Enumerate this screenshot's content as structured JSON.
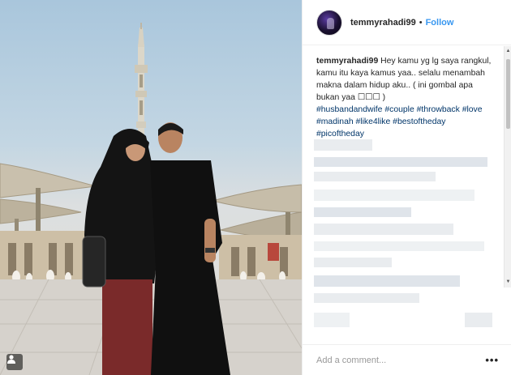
{
  "post": {
    "photo_description_icon": "user-tag-icon",
    "account": {
      "username": "temmyrahadi99",
      "separator": "•",
      "follow_label": "Follow"
    },
    "caption": {
      "username": "temmyrahadi99",
      "text": " Hey kamu yg lg saya rangkul, kamu itu kaya kamus yaa.. selalu menambah makna dalam hidup aku.. ( ini gombal apa bukan yaa ☐☐☐ )",
      "hashtags": [
        "#husbandandwife",
        "#couple",
        "#throwback",
        "#love",
        "#madinah",
        "#like4like",
        "#bestoftheday",
        "#picoftheday"
      ]
    },
    "comment_box": {
      "placeholder": "Add a comment...",
      "more_label": "•••"
    }
  },
  "colors": {
    "link_blue": "#3897f0",
    "hashtag": "#003569",
    "text": "#262626",
    "border": "#efefef"
  }
}
